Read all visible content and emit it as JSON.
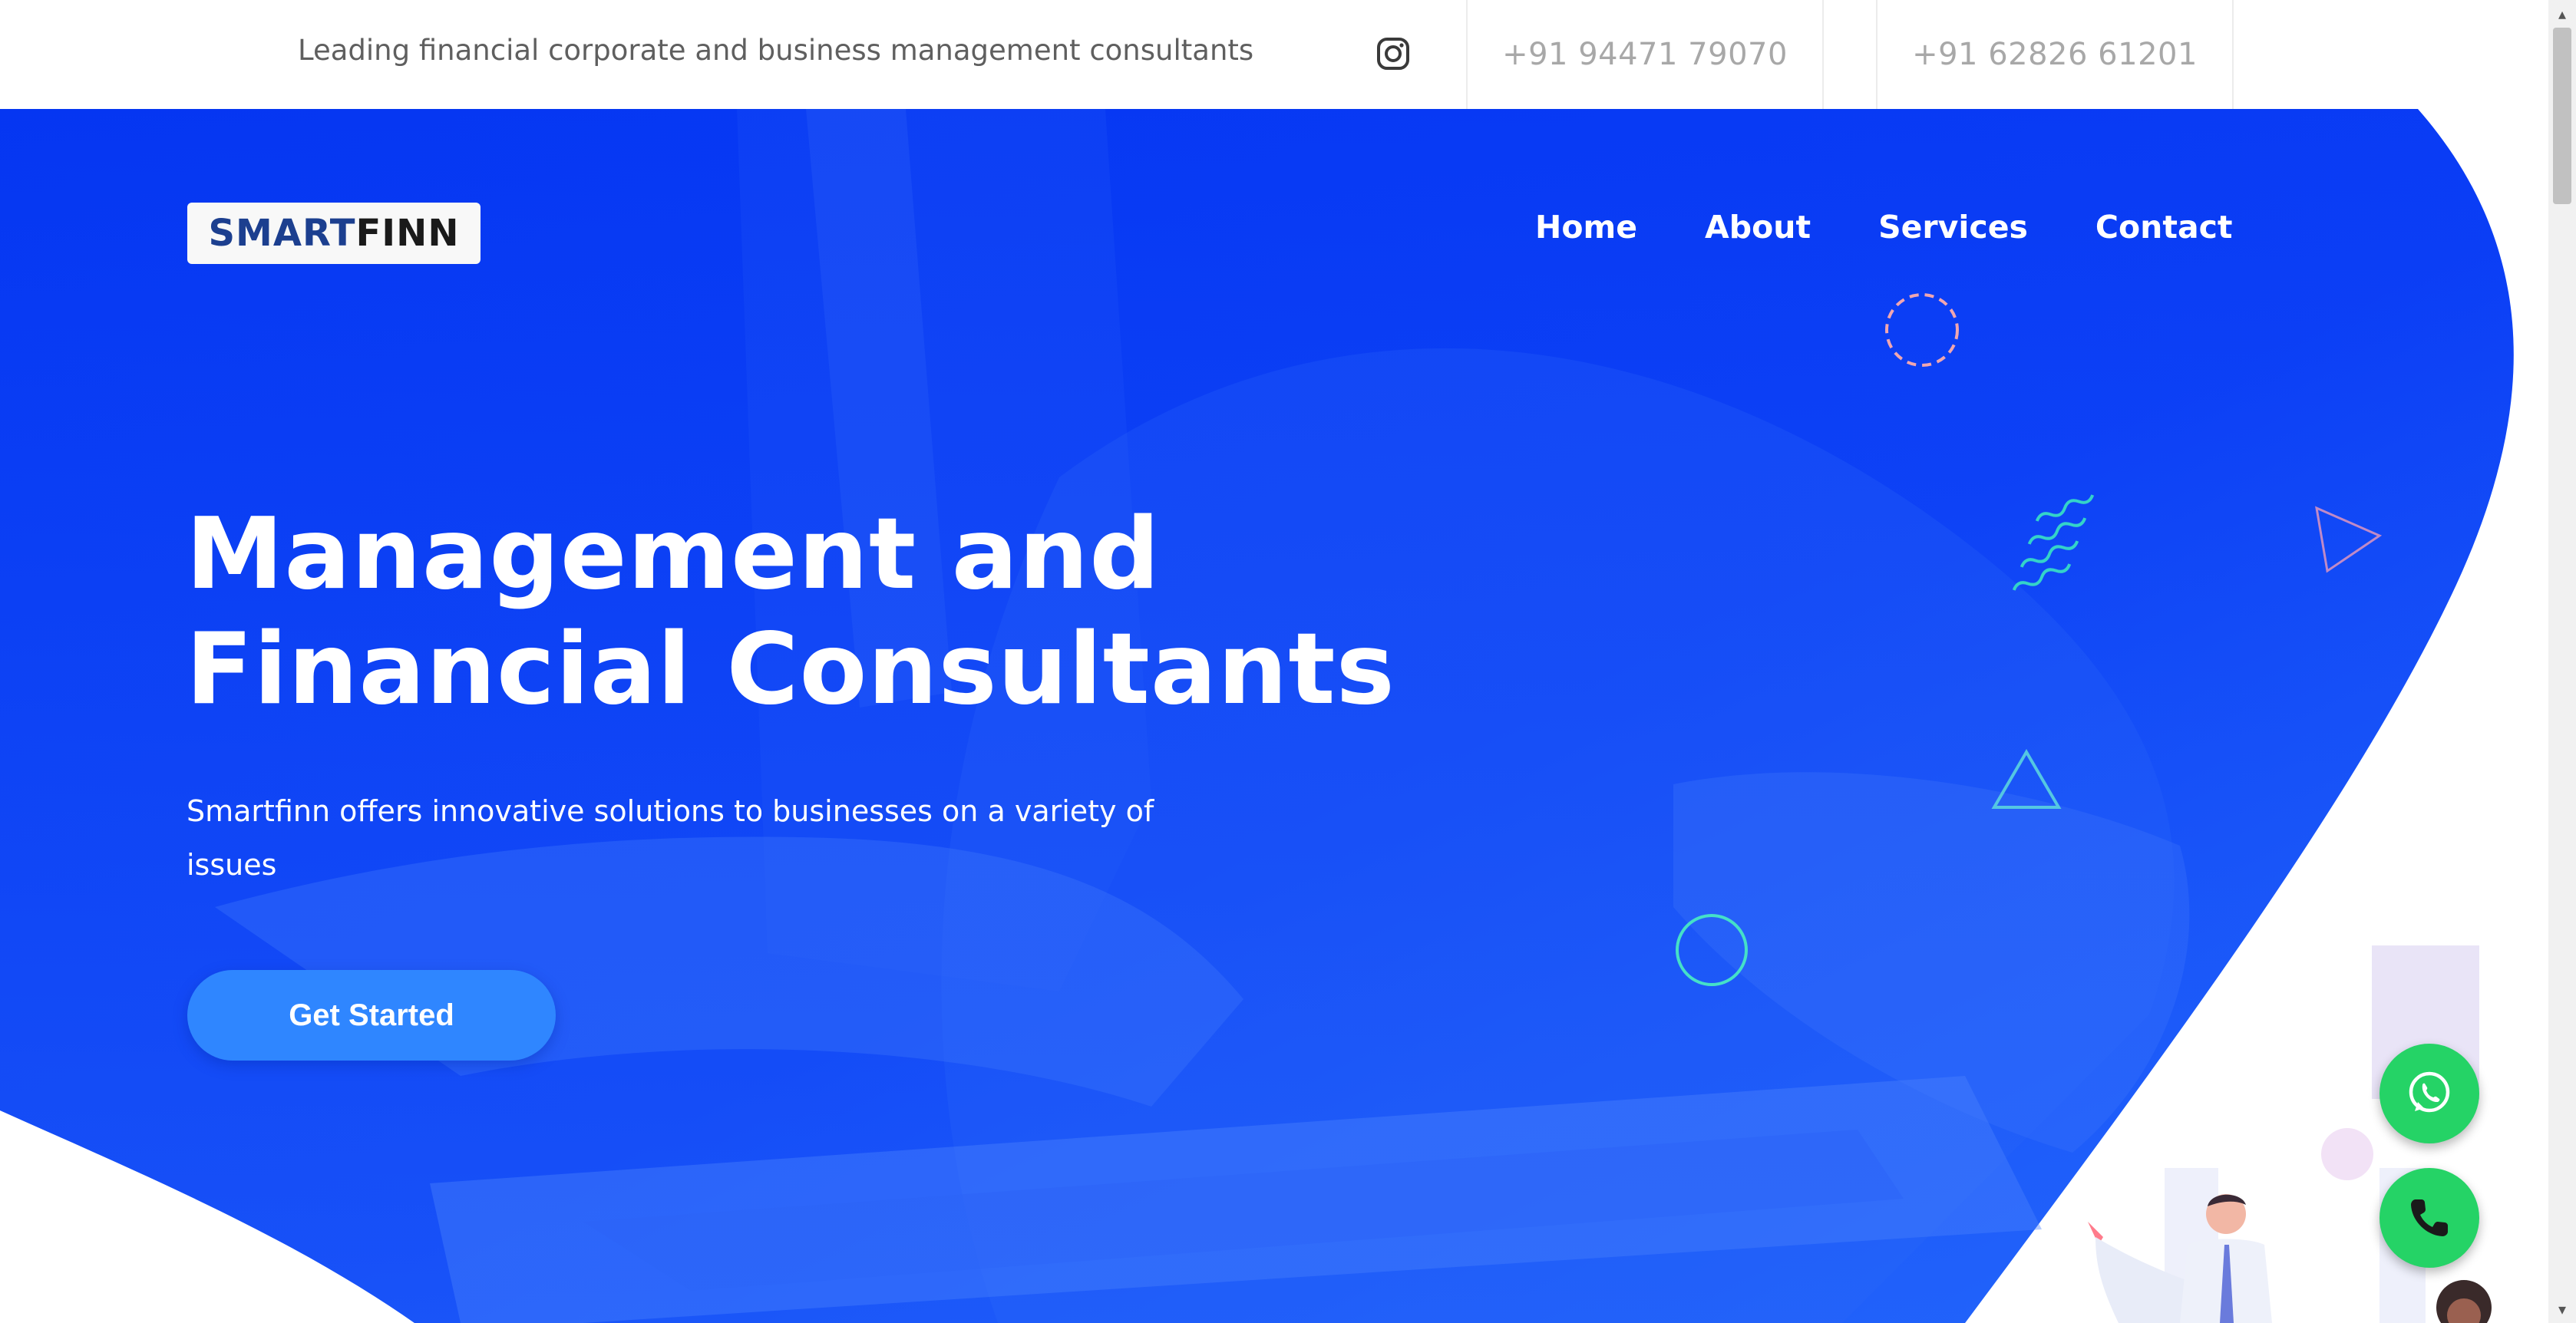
{
  "topbar": {
    "tagline": "Leading financial corporate and business management consultants",
    "phone1": "+91 94471 79070",
    "phone2": "+91 62826 61201",
    "social_icon": "instagram-icon"
  },
  "logo": {
    "part1": "SMART",
    "part2": "FINN"
  },
  "nav": {
    "home": "Home",
    "about": "About",
    "services": "Services",
    "contact": "Contact"
  },
  "hero": {
    "title_line1": "Management and",
    "title_line2": "Financial Consultants",
    "subtitle": "Smartfinn offers innovative solutions to businesses on a variety of issues",
    "cta_label": "Get Started"
  },
  "floating": {
    "whatsapp_icon": "whatsapp-icon",
    "phone_icon": "phone-icon"
  },
  "colors": {
    "hero_blue": "#0a3cf5",
    "hero_blue_light": "#1f5cf8",
    "cta": "#2f86ff",
    "float_green": "#25d366",
    "text_gray": "#5f5f5f",
    "phone_gray": "#a8a8a8"
  }
}
